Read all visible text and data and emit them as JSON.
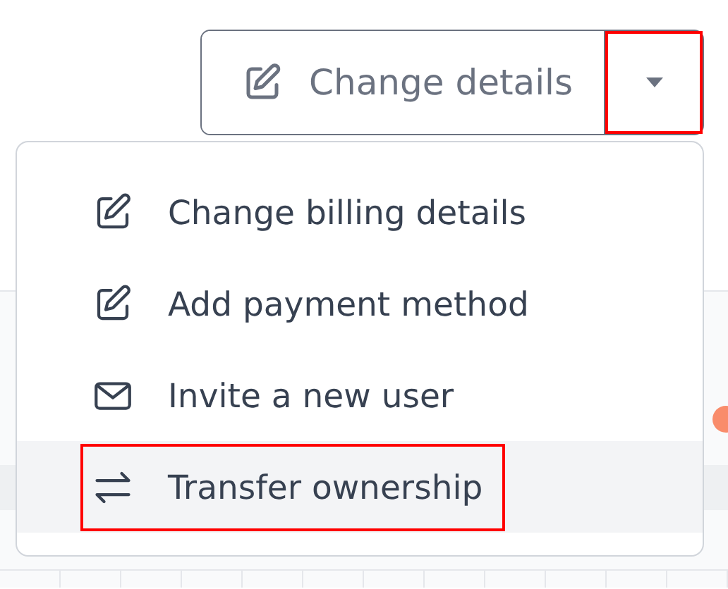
{
  "split_button": {
    "label": "Change details",
    "menu_open": true,
    "caret_highlighted": true
  },
  "menu": {
    "items": [
      {
        "label": "Change billing details",
        "kind": "edit",
        "selected": false,
        "highlighted": false
      },
      {
        "label": "Add payment method",
        "kind": "edit",
        "selected": false,
        "highlighted": false
      },
      {
        "label": "Invite a new user",
        "kind": "mail",
        "selected": false,
        "highlighted": false
      },
      {
        "label": "Transfer ownership",
        "kind": "transfer",
        "selected": true,
        "highlighted": true
      }
    ]
  },
  "background": {
    "status_dot": {
      "color": "#f98c6b"
    }
  }
}
